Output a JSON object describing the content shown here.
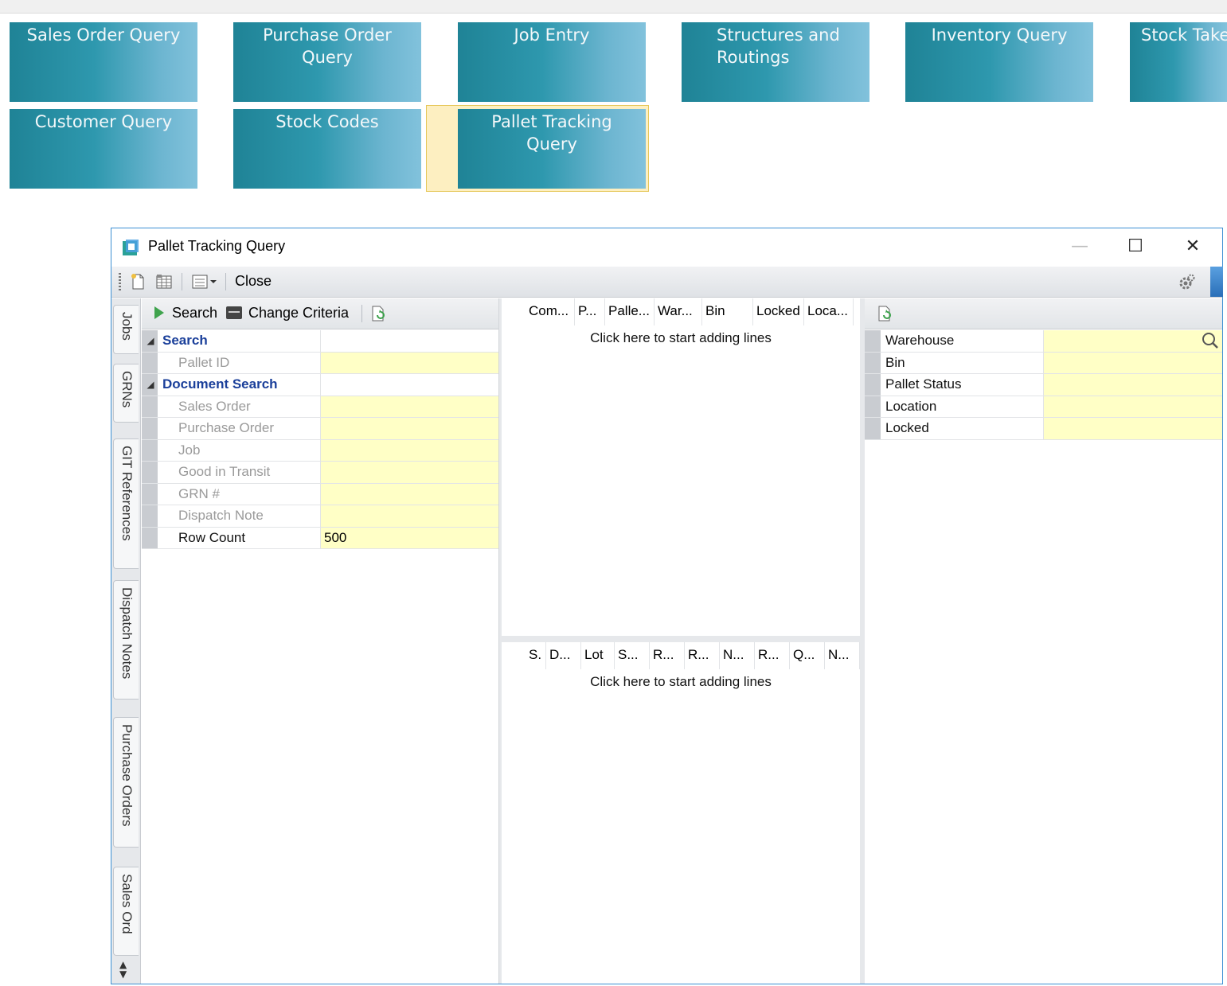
{
  "tiles": [
    {
      "label": "Sales Order Query"
    },
    {
      "label": "Purchase Order Query"
    },
    {
      "label": "Job Entry"
    },
    {
      "label": "Structures and Routings"
    },
    {
      "label": "Inventory Query"
    },
    {
      "label": "Stock Take"
    },
    {
      "label": "Customer Query"
    },
    {
      "label": "Stock Codes"
    },
    {
      "label": "Pallet Tracking Query"
    }
  ],
  "window": {
    "title": "Pallet Tracking Query",
    "close_label": "Close"
  },
  "side_tabs": [
    "Jobs",
    "GRNs",
    "GIT References",
    "Dispatch Notes",
    "Purchase Orders",
    "Sales Ord"
  ],
  "search_panel": {
    "search_label": "Search",
    "change_criteria_label": "Change Criteria",
    "rows": [
      {
        "label": "Search",
        "value": ""
      },
      {
        "label": "Pallet ID",
        "value": ""
      },
      {
        "label": "Document Search",
        "value": ""
      },
      {
        "label": "Sales Order",
        "value": ""
      },
      {
        "label": "Purchase Order",
        "value": ""
      },
      {
        "label": "Job",
        "value": ""
      },
      {
        "label": "Good in Transit",
        "value": ""
      },
      {
        "label": "GRN #",
        "value": ""
      },
      {
        "label": "Dispatch Note",
        "value": ""
      },
      {
        "label": "Row Count",
        "value": "500"
      }
    ]
  },
  "top_grid": {
    "columns": [
      "Com...",
      "P...",
      "Palle...",
      "War...",
      "Bin",
      "Locked",
      "Loca..."
    ],
    "empty_text": "Click here to start adding lines"
  },
  "bottom_grid": {
    "columns": [
      "S.",
      "D...",
      "Lot",
      "S...",
      "R...",
      "R...",
      "N...",
      "R...",
      "Q...",
      "N..."
    ],
    "empty_text": "Click here to start adding lines"
  },
  "filter_panel": {
    "rows": [
      {
        "label": "Warehouse",
        "value": ""
      },
      {
        "label": "Bin",
        "value": ""
      },
      {
        "label": "Pallet Status",
        "value": ""
      },
      {
        "label": "Location",
        "value": ""
      },
      {
        "label": "Locked",
        "value": ""
      }
    ]
  },
  "colors": {
    "tile_start": "#1f8396",
    "tile_end": "#82c2dc",
    "selected_frame": "#fdefc1",
    "input_yellow": "#ffffc6",
    "category_blue": "#1a3f9a",
    "window_border": "#3b8fd3"
  },
  "icons": {
    "app": "pallet-app-icon",
    "new": "new-document-icon",
    "grid": "grid-layout-icon",
    "view": "view-options-icon",
    "gear": "gear-icon",
    "refresh": "refresh-document-icon",
    "search": "magnifier-icon"
  }
}
